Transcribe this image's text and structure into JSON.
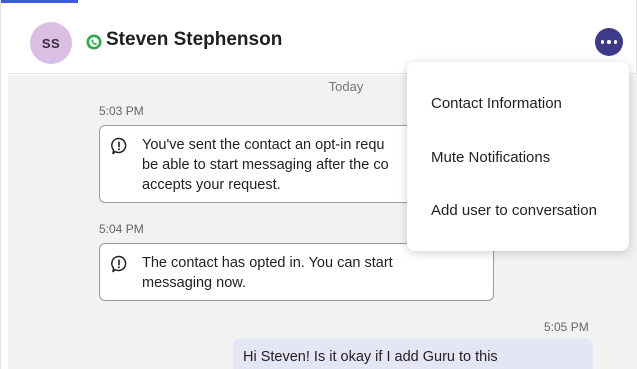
{
  "header": {
    "avatar_initials": "SS",
    "contact_name": "Steven Stephenson",
    "channel_icon": "whatsapp-icon",
    "more_icon": "more-horizontal-icon"
  },
  "conversation": {
    "date_separator": "Today",
    "events": [
      {
        "time": "5:03 PM",
        "lines": [
          "You've sent the contact an opt-in requ",
          "be able to start messaging after the co",
          "accepts your request."
        ]
      },
      {
        "time": "5:04 PM",
        "lines": [
          "The contact has opted in. You can start",
          "messaging now."
        ]
      }
    ],
    "outgoing": {
      "time": "5:05 PM",
      "text": "Hi Steven! Is it okay if I add Guru to this"
    }
  },
  "menu": {
    "items": [
      "Contact Information",
      "Mute Notifications",
      "Add user to conversation"
    ]
  },
  "colors": {
    "accent": "#3d3a8a",
    "avatar_bg": "#d9bfe3",
    "whatsapp": "#2fa84f",
    "outgoing_bubble": "#e4e5f7"
  }
}
